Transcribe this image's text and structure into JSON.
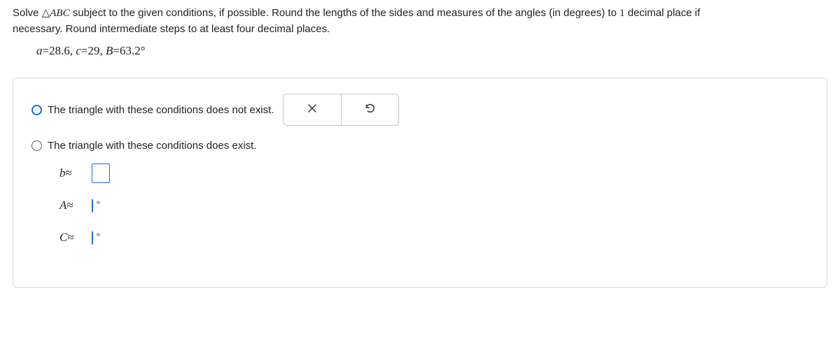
{
  "problem": {
    "line1_a": "Solve ",
    "line1_tri": "△",
    "line1_abc": "ABC",
    "line1_b": " subject to the given conditions, if possible. Round the lengths of the sides and measures of the angles (in degrees) to ",
    "line1_one": "1",
    "line1_c": " decimal place if",
    "line2": "necessary. Round intermediate steps to at least four decimal places."
  },
  "given": {
    "a_var": "a",
    "eq": "=",
    "a_val": "28.6",
    "comma": ", ",
    "c_var": "c",
    "c_val": "29",
    "B_var": "B",
    "B_val": "63.2",
    "deg": "°"
  },
  "choices": {
    "not_exist": "The triangle with these conditions does not exist.",
    "does_exist": "The triangle with these conditions does exist."
  },
  "answers": {
    "b_label_var": "b",
    "A_label_var": "A",
    "C_label_var": "C",
    "approx": "≈",
    "deg": "°",
    "b_value": "",
    "A_value": "",
    "C_value": ""
  },
  "icons": {
    "clear": "close-icon",
    "reset": "undo-icon"
  }
}
